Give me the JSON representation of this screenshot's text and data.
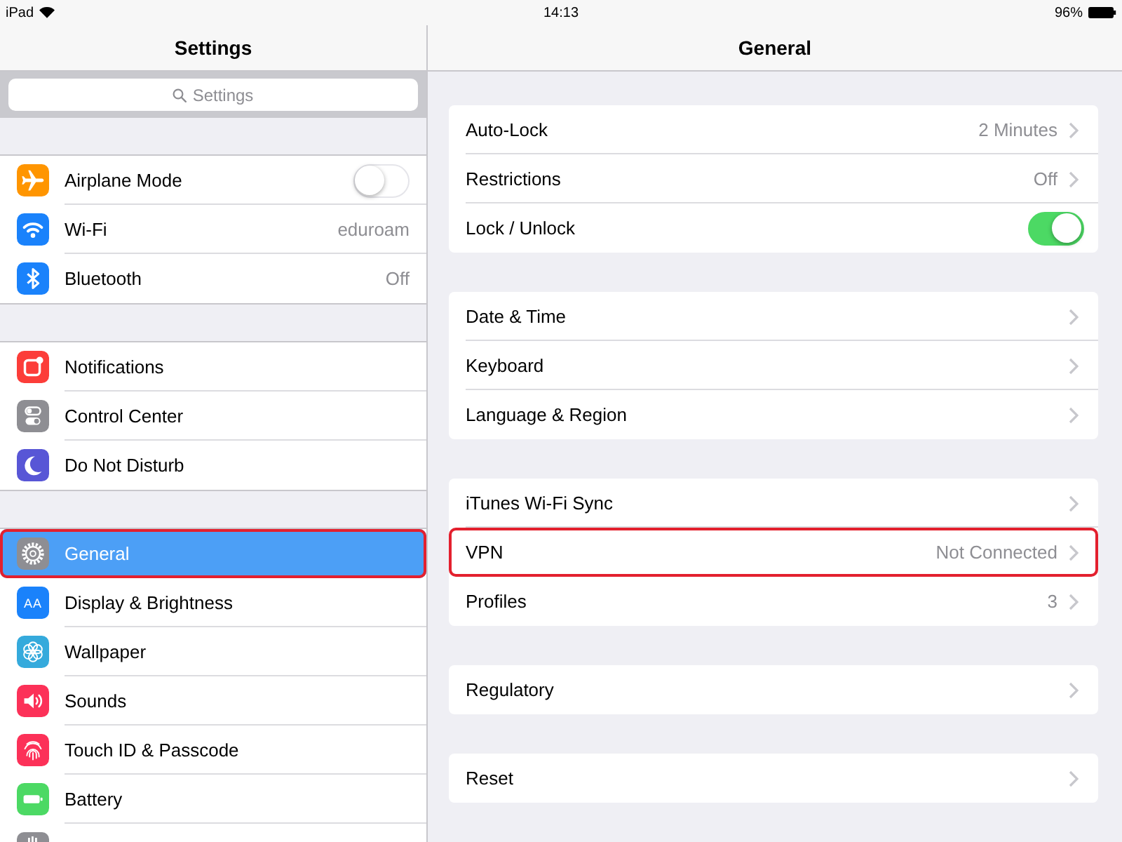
{
  "status_bar": {
    "device": "iPad",
    "time": "14:13",
    "battery": "96%"
  },
  "sidebar": {
    "title": "Settings",
    "search": {
      "placeholder": "Settings"
    },
    "groups": [
      {
        "items": [
          {
            "kind": "toggle",
            "label": "Airplane Mode",
            "on": false,
            "selected": false,
            "outlined": false
          },
          {
            "kind": "detail",
            "label": "Wi-Fi",
            "value": "eduroam",
            "selected": false,
            "outlined": false
          },
          {
            "kind": "detail",
            "label": "Bluetooth",
            "value": "Off",
            "selected": false,
            "outlined": false
          }
        ]
      },
      {
        "items": [
          {
            "kind": "plain",
            "label": "Notifications",
            "selected": false,
            "outlined": false
          },
          {
            "kind": "plain",
            "label": "Control Center",
            "selected": false,
            "outlined": false
          },
          {
            "kind": "plain",
            "label": "Do Not Disturb",
            "selected": false,
            "outlined": false
          }
        ]
      },
      {
        "items": [
          {
            "kind": "plain",
            "label": "General",
            "selected": true,
            "outlined": true
          },
          {
            "kind": "plain",
            "label": "Display & Brightness",
            "icon_text": "AA",
            "selected": false,
            "outlined": false
          },
          {
            "kind": "plain",
            "label": "Wallpaper",
            "selected": false,
            "outlined": false
          },
          {
            "kind": "plain",
            "label": "Sounds",
            "selected": false,
            "outlined": false
          },
          {
            "kind": "plain",
            "label": "Touch ID & Passcode",
            "selected": false,
            "outlined": false
          },
          {
            "kind": "plain",
            "label": "Battery",
            "selected": false,
            "outlined": false
          },
          {
            "kind": "partial",
            "selected": false,
            "outlined": false
          }
        ]
      }
    ]
  },
  "detail": {
    "title": "General",
    "groups": [
      {
        "items": [
          {
            "kind": "disclosure",
            "label": "Auto-Lock",
            "value": "2 Minutes",
            "outlined": false
          },
          {
            "kind": "disclosure",
            "label": "Restrictions",
            "value": "Off",
            "outlined": false
          },
          {
            "kind": "toggle",
            "label": "Lock / Unlock",
            "on": true,
            "outlined": false
          }
        ]
      },
      {
        "items": [
          {
            "kind": "disclosure",
            "label": "Date & Time",
            "outlined": false
          },
          {
            "kind": "disclosure",
            "label": "Keyboard",
            "outlined": false
          },
          {
            "kind": "disclosure",
            "label": "Language & Region",
            "outlined": false
          }
        ]
      },
      {
        "items": [
          {
            "kind": "disclosure",
            "label": "iTunes Wi-Fi Sync",
            "outlined": false
          },
          {
            "kind": "disclosure",
            "label": "VPN",
            "value": "Not Connected",
            "outlined": true
          },
          {
            "kind": "disclosure",
            "label": "Profiles",
            "value": "3",
            "outlined": false
          }
        ]
      },
      {
        "items": [
          {
            "kind": "disclosure",
            "label": "Regulatory",
            "outlined": false
          }
        ]
      },
      {
        "items": [
          {
            "kind": "disclosure",
            "label": "Reset",
            "outlined": false
          }
        ]
      }
    ]
  }
}
